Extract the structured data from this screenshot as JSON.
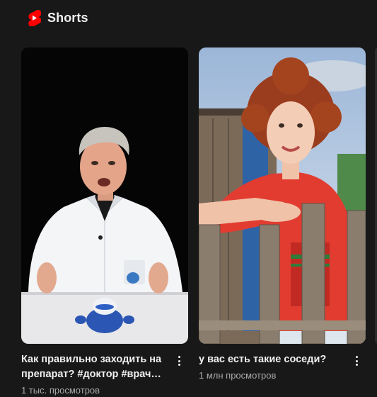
{
  "section": {
    "title": "Shorts",
    "logo_color": "#ff0000"
  },
  "cards": [
    {
      "title": "Как правильно заходить на препарат? #доктор #врач…",
      "views": "1 тыс. просмотров",
      "thumbnail": "man-in-white-coat-with-toy"
    },
    {
      "title": "у вас есть такие соседи?",
      "views": "1 млн просмотров",
      "thumbnail": "curly-haired-woman-at-fence"
    }
  ],
  "icons": [
    "shorts-logo-icon",
    "more-vert-icon"
  ]
}
